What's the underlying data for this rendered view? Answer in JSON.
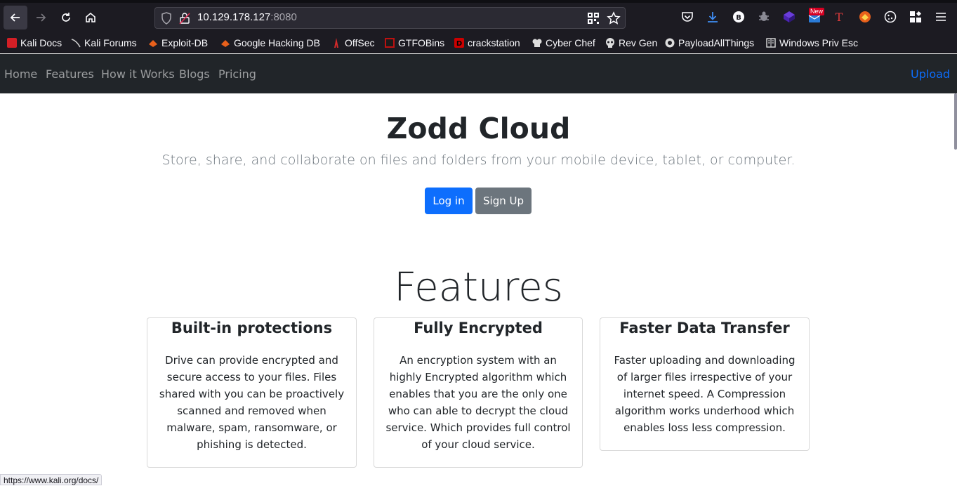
{
  "browser": {
    "url_host": "10.129.178.127",
    "url_port": ":8080",
    "new_badge": "New",
    "status_url": "https://www.kali.org/docs/"
  },
  "bookmarks": [
    {
      "label": "Kali Docs",
      "icon": "kali-docs-icon",
      "color": "#d41f26"
    },
    {
      "label": "Kali Forums",
      "icon": "kali-dragon-icon",
      "color": "#c9c9c9"
    },
    {
      "label": "Exploit-DB",
      "icon": "exploitdb-icon",
      "color": "#e8601b"
    },
    {
      "label": "Google Hacking DB",
      "icon": "ghdb-icon",
      "color": "#e8601b"
    },
    {
      "label": "OffSec",
      "icon": "offsec-icon",
      "color": "#d52a2a"
    },
    {
      "label": "GTFOBins",
      "icon": "gtfobins-icon",
      "color": "#b11"
    },
    {
      "label": "crackstation",
      "icon": "crackstation-icon",
      "color": "#c00"
    },
    {
      "label": "Cyber Chef",
      "icon": "cyberchef-icon",
      "color": "#ddd"
    },
    {
      "label": "Rev Gen",
      "icon": "skull-icon",
      "color": "#ddd"
    },
    {
      "label": "PayloadAllThings",
      "icon": "github-icon",
      "color": "#ddd"
    },
    {
      "label": "Windows Priv Esc",
      "icon": "book-icon",
      "color": "#ddd"
    }
  ],
  "nav": {
    "home": "Home",
    "features": "Features",
    "how": "How it Works",
    "blogs": "Blogs",
    "pricing": "Pricing",
    "upload": "Upload"
  },
  "hero": {
    "title": "Zodd Cloud",
    "subtitle": "Store, share, and collaborate on files and folders from your mobile device, tablet, or computer.",
    "login": "Log in",
    "signup": "Sign Up"
  },
  "features": {
    "title": "Features",
    "cards": [
      {
        "title": "Built-in protections",
        "body": "Drive can provide encrypted and secure access to your files. Files shared with you can be proactively scanned and removed when malware, spam, ransomware, or phishing is detected."
      },
      {
        "title": "Fully Encrypted",
        "body": "An encryption system with an highly Encrypted algorithm which enables that you are the only one who can able to decrypt the cloud service. Which provides full control of your cloud service."
      },
      {
        "title": "Faster Data Transfer",
        "body": "Faster uploading and downloading of larger files irrespective of your internet speed. A Compression algorithm works underhood which enables loss less compression."
      }
    ]
  },
  "colors": {
    "primary": "#0d6efd",
    "secondary": "#6c757d",
    "navbar": "#212529"
  }
}
